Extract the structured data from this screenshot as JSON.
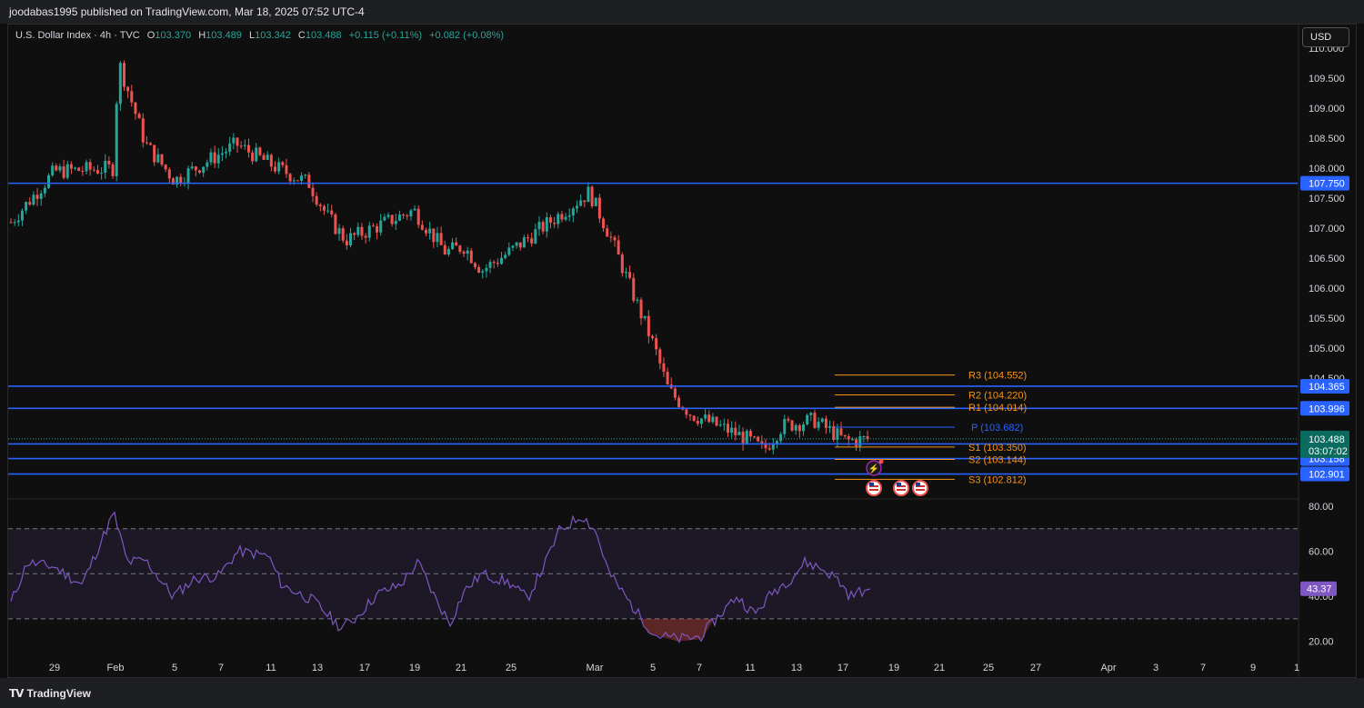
{
  "header": {
    "publisher_text": "joodabas1995 published on TradingView.com, Mar 18, 2025 07:52 UTC-4"
  },
  "legend": {
    "symbol": "U.S. Dollar Index · 4h · TVC",
    "open_label": "O",
    "open": "103.370",
    "high_label": "H",
    "high": "103.489",
    "low_label": "L",
    "low": "103.342",
    "close_label": "C",
    "close": "103.488",
    "change": "+0.115 (+0.11%)",
    "change2": "+0.082 (+0.08%)"
  },
  "currency_button": "USD",
  "colors": {
    "up": "#26a69a",
    "down": "#ef5350",
    "level": "#2962ff",
    "pivot_orange": "#f7931a",
    "pivot_blue": "#2962ff",
    "rsi": "#7e57c2"
  },
  "price_axis": {
    "min": 102.5,
    "max": 110.2,
    "ticks": [
      "110.000",
      "109.500",
      "109.000",
      "108.500",
      "108.000",
      "107.500",
      "107.000",
      "106.500",
      "106.000",
      "105.500",
      "105.000",
      "104.500"
    ]
  },
  "level_lines": [
    {
      "price": 107.75,
      "label": "107.750"
    },
    {
      "price": 104.365,
      "label": "104.365"
    },
    {
      "price": 103.996,
      "label": "103.996"
    },
    {
      "price": 103.403,
      "label": "103.403"
    },
    {
      "price": 103.158,
      "label": "103.158"
    },
    {
      "price": 102.901,
      "label": "102.901"
    }
  ],
  "last_price": {
    "label": "103.488",
    "countdown": "03:07:02",
    "price": 103.488
  },
  "pivots": [
    {
      "name": "R3 (104.552)",
      "price": 104.552,
      "color": "orange"
    },
    {
      "name": "R2 (104.220)",
      "price": 104.22,
      "color": "orange"
    },
    {
      "name": "R1 (104.014)",
      "price": 104.014,
      "color": "orange"
    },
    {
      "name": "P (103.682)",
      "price": 103.682,
      "color": "blue"
    },
    {
      "name": "S1 (103.350)",
      "price": 103.35,
      "color": "orange"
    },
    {
      "name": "S2 (103.144)",
      "price": 103.144,
      "color": "orange"
    },
    {
      "name": "S3 (102.812)",
      "price": 102.812,
      "color": "orange"
    }
  ],
  "rsi_axis": {
    "min": 15,
    "max": 82,
    "ticks": [
      "80.00",
      "60.00",
      "40.00",
      "20.00"
    ],
    "current": "43.37",
    "current_value": 43.37
  },
  "time_axis": [
    "29",
    "Feb",
    "5",
    "7",
    "11",
    "13",
    "17",
    "19",
    "21",
    "25",
    "Mar",
    "5",
    "7",
    "11",
    "13",
    "17",
    "19",
    "21",
    "25",
    "27",
    "Apr",
    "3",
    "7",
    "9",
    "1"
  ],
  "chart_data": {
    "type": "candlestick",
    "title": "U.S. Dollar Index · 4h · TVC",
    "interval": "4h",
    "ohlc_last": {
      "open": 103.37,
      "high": 103.489,
      "low": 103.342,
      "close": 103.488
    },
    "close_path_dates": [
      "Jan 27",
      "Jan 29",
      "Feb 1",
      "Feb 2",
      "Feb 4",
      "Feb 6",
      "Feb 10",
      "Feb 12",
      "Feb 13",
      "Feb 14",
      "Feb 18",
      "Feb 19",
      "Feb 20",
      "Feb 21",
      "Feb 24",
      "Feb 26",
      "Feb 28",
      "Mar 3",
      "Mar 4",
      "Mar 5",
      "Mar 6",
      "Mar 10",
      "Mar 11",
      "Mar 12",
      "Mar 14",
      "Mar 17",
      "Mar 18"
    ],
    "close_path_values": [
      107.1,
      107.95,
      108.0,
      109.8,
      108.4,
      107.8,
      108.4,
      108.0,
      107.75,
      107.2,
      106.8,
      107.3,
      106.6,
      106.7,
      106.3,
      106.6,
      107.6,
      106.9,
      105.0,
      104.3,
      103.9,
      103.5,
      103.3,
      103.7,
      103.8,
      103.45,
      103.488
    ],
    "rsi": {
      "name": "RSI",
      "bands": [
        70,
        50,
        30
      ],
      "current": 43.37
    }
  },
  "footer": {
    "brand": "TradingView"
  }
}
